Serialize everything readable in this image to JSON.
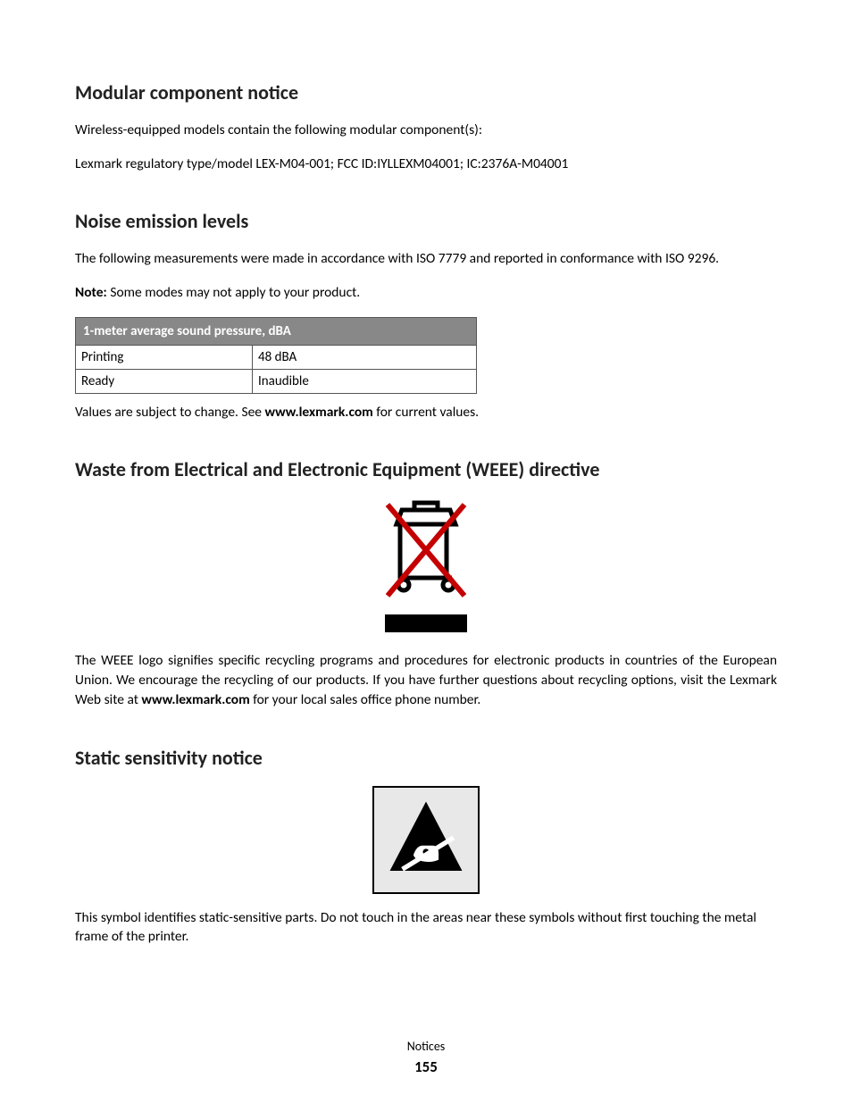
{
  "section1": {
    "heading": "Modular component notice",
    "p1": "Wireless-equipped models contain the following modular component(s):",
    "p2": "Lexmark regulatory type/model LEX-M04-001; FCC ID:IYLLEXM04001; IC:2376A-M04001"
  },
  "section2": {
    "heading": "Noise emission levels",
    "p1": "The following measurements were made in accordance with ISO 7779 and reported in conformance with ISO 9296.",
    "noteLabel": "Note:",
    "noteText": " Some modes may not apply to your product.",
    "tableHeader": "1-meter average sound pressure, dBA",
    "rows": [
      {
        "label": "Printing",
        "value": "48 dBA"
      },
      {
        "label": "Ready",
        "value": "Inaudible"
      }
    ],
    "afterTablePre": "Values are subject to change. See ",
    "afterTableBold": "www.lexmark.com",
    "afterTablePost": " for current values."
  },
  "section3": {
    "heading": "Waste from Electrical and Electronic Equipment (WEEE) directive",
    "p1Pre": "The WEEE logo signifies specific recycling programs and procedures for electronic products in countries of the European Union. We encourage the recycling of our products. If you have further questions about recycling options, visit the Lexmark Web site at ",
    "p1Bold": "www.lexmark.com",
    "p1Post": " for your local sales office phone number."
  },
  "section4": {
    "heading": "Static sensitivity notice",
    "p1": "This symbol identifies static-sensitive parts. Do not touch in the areas near these symbols without first touching the metal frame of the printer."
  },
  "footer": {
    "label": "Notices",
    "page": "155"
  }
}
